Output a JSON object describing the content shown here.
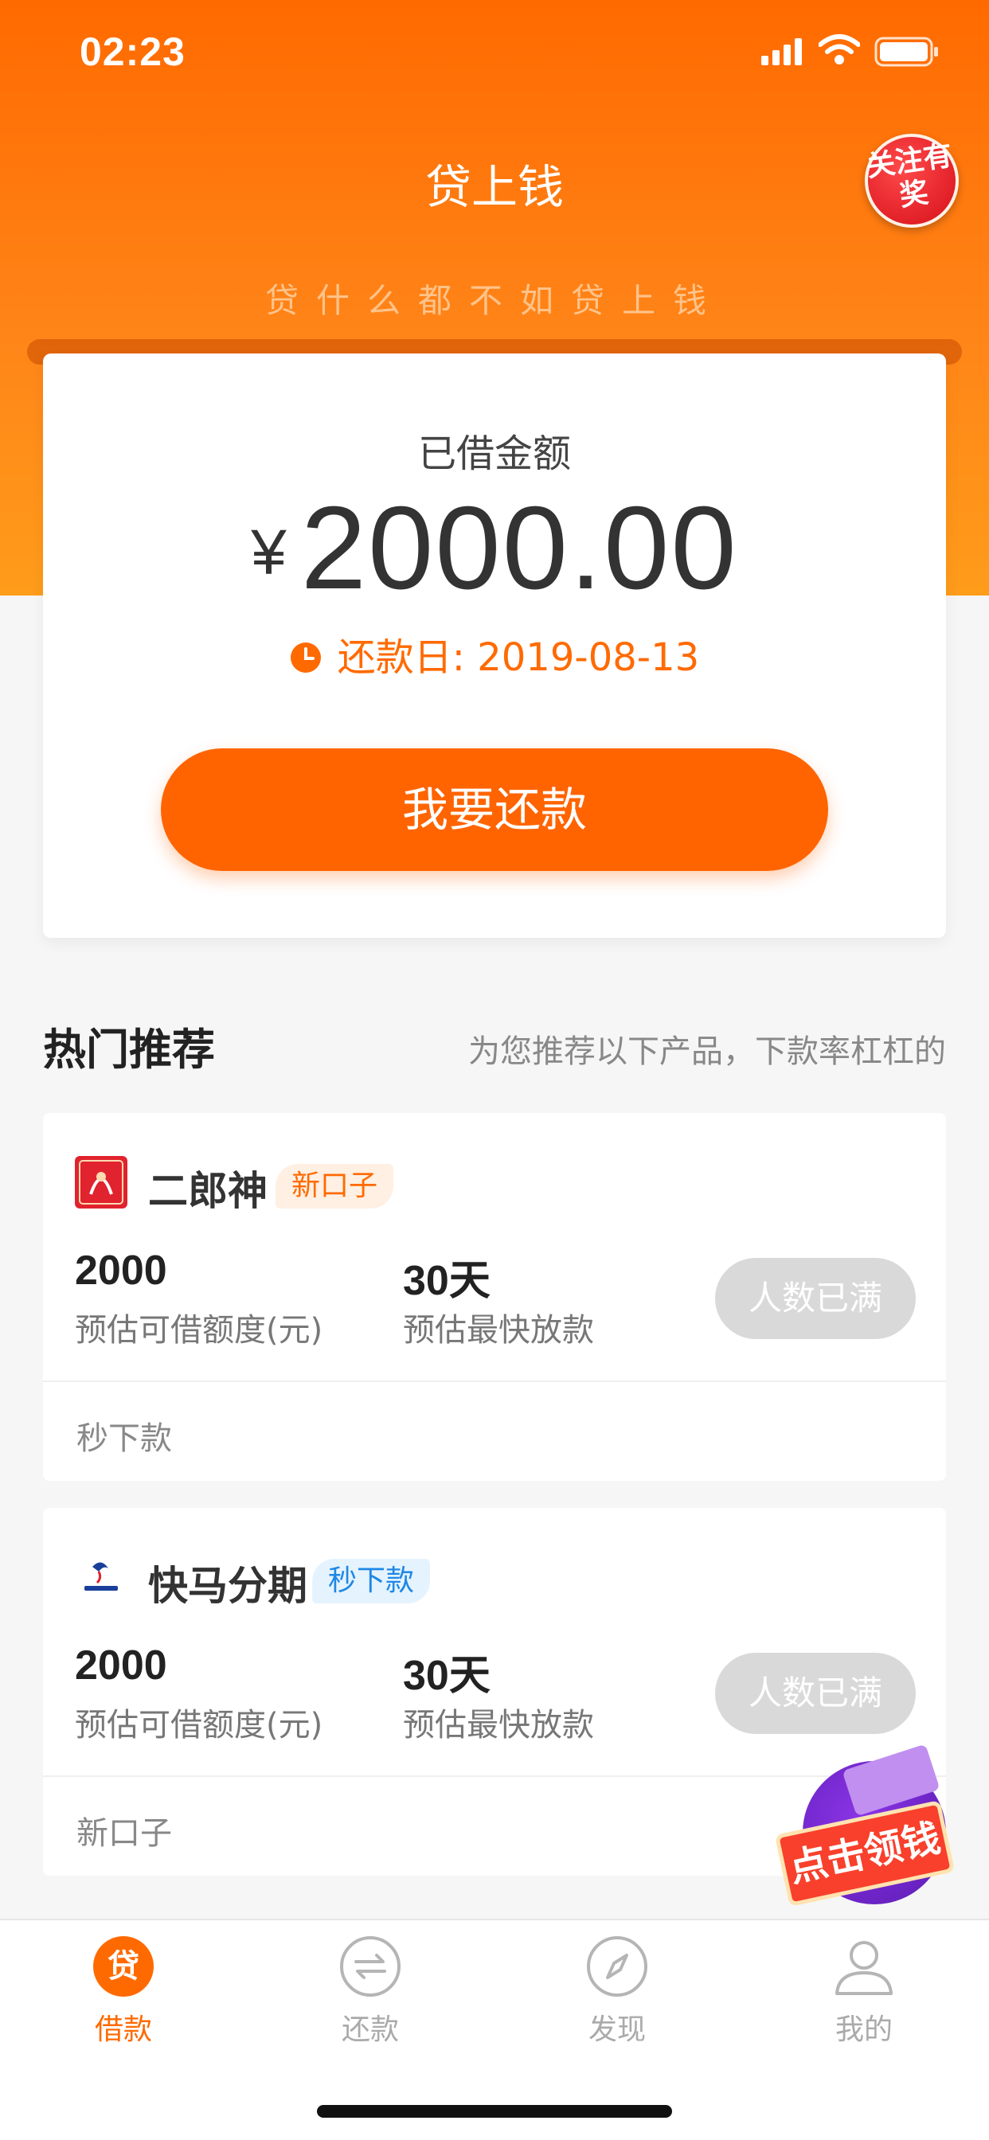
{
  "status_bar": {
    "time": "02:23"
  },
  "header": {
    "title": "贷上钱",
    "slogan": "贷什么都不如贷上钱",
    "promo_badge": "关注有奖"
  },
  "loan": {
    "label": "已借金额",
    "currency": "¥",
    "amount": "2000.00",
    "due_text": "还款日: 2019-08-13",
    "repay_button": "我要还款"
  },
  "recommend": {
    "title": "热门推荐",
    "subtitle": "为您推荐以下产品，下款率杠杠的",
    "products": [
      {
        "name": "二郎神",
        "tag": "新口子",
        "amount": "2000",
        "amount_label": "预估可借额度(元)",
        "days": "30天",
        "days_label": "预估最快放款",
        "button": "人数已满",
        "footer": "秒下款"
      },
      {
        "name": "快马分期",
        "tag": "秒下款",
        "amount": "2000",
        "amount_label": "预估可借额度(元)",
        "days": "30天",
        "days_label": "预估最快放款",
        "button": "人数已满",
        "footer": "新口子"
      }
    ]
  },
  "float_ad": {
    "label": "点击领钱"
  },
  "tabs": [
    {
      "label": "借款",
      "icon": "loan-icon",
      "active": true
    },
    {
      "label": "还款",
      "icon": "repay-icon",
      "active": false
    },
    {
      "label": "发现",
      "icon": "compass-icon",
      "active": false
    },
    {
      "label": "我的",
      "icon": "user-icon",
      "active": false
    }
  ],
  "colors": {
    "brand": "#ff6a00",
    "disabled": "#d9d9d9",
    "tag_orange_bg": "#fff0e3",
    "tag_blue_bg": "#e5f3ff",
    "tag_blue_text": "#1e88e5"
  }
}
